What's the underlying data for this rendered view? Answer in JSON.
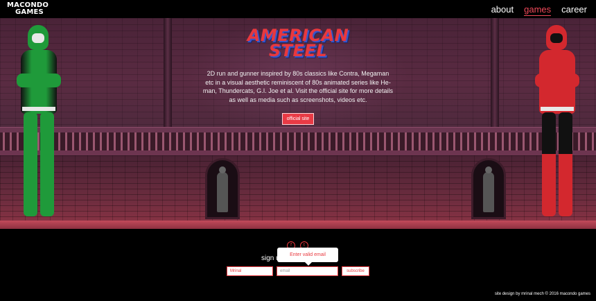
{
  "header": {
    "logo_line1": "MACONDO",
    "logo_line2": "GAMES",
    "nav": [
      {
        "label": "about",
        "active": false
      },
      {
        "label": "games",
        "active": true
      },
      {
        "label": "career",
        "active": false
      }
    ]
  },
  "hero": {
    "title_line1": "AMERICAN",
    "title_line2": "STEEL",
    "description": "2D run and gunner inspired by 80s classics like Contra, Megaman etc in a visual aesthetic reminiscent of 80s animated series like He-man, Thundercats, G.I. Joe et al. Visit the official site for more details as well as media such as screenshots, videos etc.",
    "button_label": "official site"
  },
  "footer": {
    "social": [
      {
        "icon": "facebook-icon",
        "glyph": "f"
      },
      {
        "icon": "twitter-icon",
        "glyph": "t"
      }
    ],
    "signup_label": "sign up",
    "tooltip": "Enter valid email",
    "name_value": "Mrinal",
    "email_placeholder": "email",
    "subscribe_label": "subscribe",
    "credit": "site design by mrinal mech  © 2016 macondo games"
  },
  "colors": {
    "accent": "#e8383e",
    "nav_active": "#f2495a",
    "green_hero": "#1f9a3a",
    "red_hero": "#d3282e"
  }
}
